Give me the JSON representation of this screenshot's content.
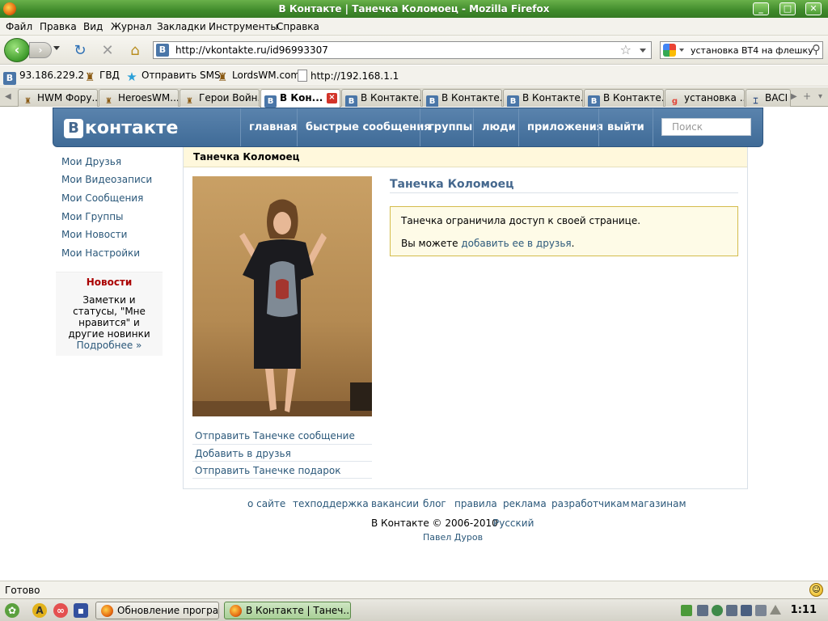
{
  "window": {
    "title": "В Контакте | Танечка Коломоец - Mozilla Firefox"
  },
  "menu": [
    "Файл",
    "Правка",
    "Вид",
    "Журнал",
    "Закладки",
    "Инструменты",
    "Справка"
  ],
  "address": {
    "url": "http://vkontakte.ru/id96993307"
  },
  "search": {
    "query": "установка BT4 на флешку"
  },
  "bookmarks": [
    "93.186.229.2",
    "ГВД",
    "Отправить SMS",
    "LordsWM.com",
    "http://192.168.1.1"
  ],
  "tabs": [
    "HWM Фору...",
    "HeroesWM...",
    "Герои Войн...",
    "В Кон...",
    "В Контакте...",
    "В Контакте...",
    "В Контакте...",
    "В Контакте...",
    "установка ...",
    "BACI"
  ],
  "vk": {
    "logo": "контакте",
    "logo_letter": "В",
    "nav": [
      "главная",
      "быстрые сообщения",
      "группы",
      "люди",
      "приложения",
      "выйти"
    ],
    "search_placeholder": "Поиск",
    "left_menu": [
      "Мои Друзья",
      "Мои Видеозаписи",
      "Мои Сообщения",
      "Мои Группы",
      "Мои Новости",
      "Мои Настройки"
    ],
    "news": {
      "title": "Новости",
      "text": "Заметки и статусы, \"Мне нравится\" и другие новинки",
      "more": "Подробнее »"
    },
    "profile_header": "Танечка Коломоец",
    "profile_name": "Танечка Коломоец",
    "notice_line1": "Танечка ограничила доступ к своей странице.",
    "notice_line2_prefix": "Вы можете",
    "notice_link": "добавить ее в друзья",
    "notice_line2_suffix": ".",
    "actions": [
      "Отправить Танечке сообщение",
      "Добавить в друзья",
      "Отправить Танечке подарок"
    ],
    "footer_links": [
      "о сайте",
      "техподдержка",
      "вакансии",
      "блог",
      "правила",
      "реклама",
      "разработчикам",
      "магазинам"
    ],
    "copyright": "В Контакте © 2006-2010",
    "language": "Русский",
    "author": "Павел Дуров"
  },
  "status": {
    "text": "Готово"
  },
  "taskbar": {
    "tasks": [
      "Обновление програ...",
      "В Контакте | Танеч..."
    ],
    "clock": "1:11"
  }
}
